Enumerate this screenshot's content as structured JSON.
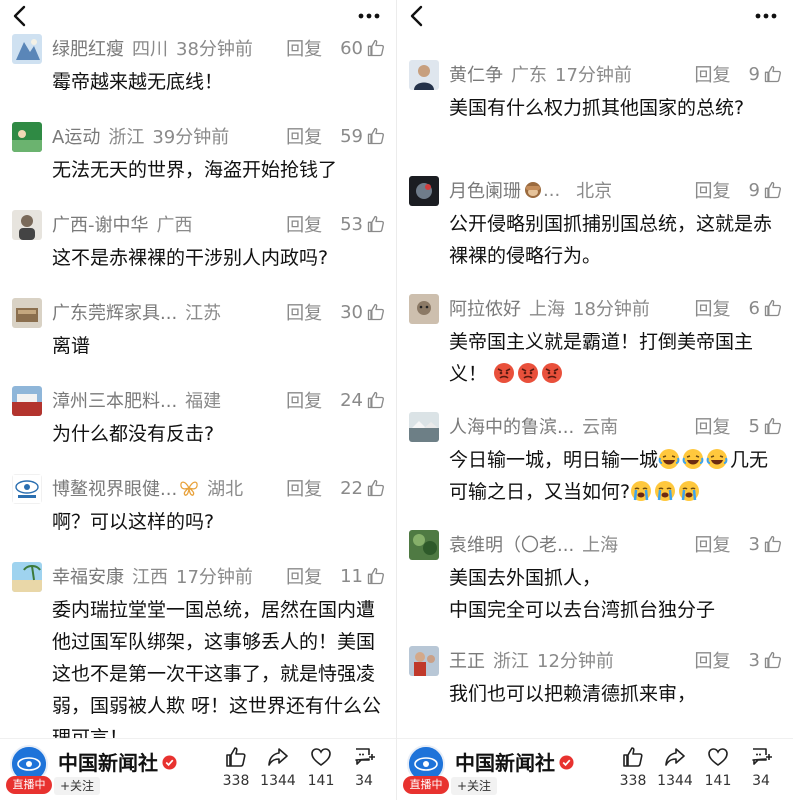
{
  "colors": {
    "brand_blue": "#1e73d9",
    "live_red": "#e8322f",
    "text_gray": "#8a8a8a"
  },
  "left": {
    "comments": [
      {
        "user": "绿肥红瘦",
        "location": "四川",
        "time": "38分钟前",
        "reply": "回复",
        "likes": "60",
        "text": "霉帝越来越无底线！"
      },
      {
        "user": "A运动",
        "location": "浙江",
        "time": "39分钟前",
        "reply": "回复",
        "likes": "59",
        "text": "无法无天的世界，海盗开始抢钱了"
      },
      {
        "user": "广西-谢中华",
        "location": "广西",
        "time": "",
        "reply": "回复",
        "likes": "53",
        "text": "这不是赤裸裸的干涉别人内政吗?"
      },
      {
        "user": "广东莞辉家具...",
        "location": "江苏",
        "time": "",
        "reply": "回复",
        "likes": "30",
        "text": "离谱"
      },
      {
        "user": "漳州三本肥料...",
        "location": "福建",
        "time": "",
        "reply": "回复",
        "likes": "24",
        "text": "为什么都没有反击?"
      },
      {
        "user": "博鳌视界眼健...",
        "location": "湖北",
        "time": "",
        "reply": "回复",
        "likes": "22",
        "text": "啊？可以这样的吗?"
      },
      {
        "user": "幸福安康",
        "location": "江西",
        "time": "17分钟前",
        "reply": "回复",
        "likes": "11",
        "text": "委内瑞拉堂堂一国总统，居然在国内遭他过国军队绑架，这事够丢人的！美国这也不是第一次干这事了，就是恃强凌弱，国弱被人欺 呀！这世界还有什么公理可言！"
      }
    ],
    "bottom": {
      "brand": "中国新闻社",
      "live": "直播中",
      "follow": "+关注",
      "likes": "338",
      "shares": "1344",
      "favorites": "141",
      "comments": "34"
    }
  },
  "right": {
    "comments": [
      {
        "user": "黄仁争",
        "location": "广东",
        "time": "17分钟前",
        "reply": "回复",
        "likes": "9",
        "text": "美国有什么权力抓其他国家的总统?"
      },
      {
        "user": "月色阑珊",
        "user_suffix": "...",
        "location": "北京",
        "time": "",
        "reply": "回复",
        "likes": "9",
        "text": "公开侵略别国抓捕别国总统，这就是赤裸裸的侵略行为。"
      },
      {
        "user": "阿拉侬好",
        "location": "上海",
        "time": "18分钟前",
        "reply": "回复",
        "likes": "6",
        "text": "美帝国主义就是霸道！打倒美帝国主义！",
        "emoji": [
          "angry",
          "angry",
          "angry"
        ]
      },
      {
        "user": "人海中的鲁滨...",
        "location": "云南",
        "time": "",
        "reply": "回复",
        "likes": "5",
        "text_a": "今日输一城，明日输一城",
        "text_b": "几无可输之日，又当如何?",
        "emoji_a": [
          "laugh-cry",
          "laugh-cry",
          "laugh-cry"
        ],
        "emoji_b": [
          "sob",
          "sob",
          "sob"
        ]
      },
      {
        "user": "袁维明（〇老...",
        "location": "上海",
        "time": "",
        "reply": "回复",
        "likes": "3",
        "text_a": "美国去外国抓人，",
        "text_b": "中国完全可以去台湾抓台独分子"
      },
      {
        "user": "王正",
        "location": "浙江",
        "time": "12分钟前",
        "reply": "回复",
        "likes": "3",
        "text": "我们也可以把赖清德抓来审，"
      }
    ],
    "bottom": {
      "brand": "中国新闻社",
      "live": "直播中",
      "follow": "+关注",
      "likes": "338",
      "shares": "1344",
      "favorites": "141",
      "comments": "34"
    }
  }
}
